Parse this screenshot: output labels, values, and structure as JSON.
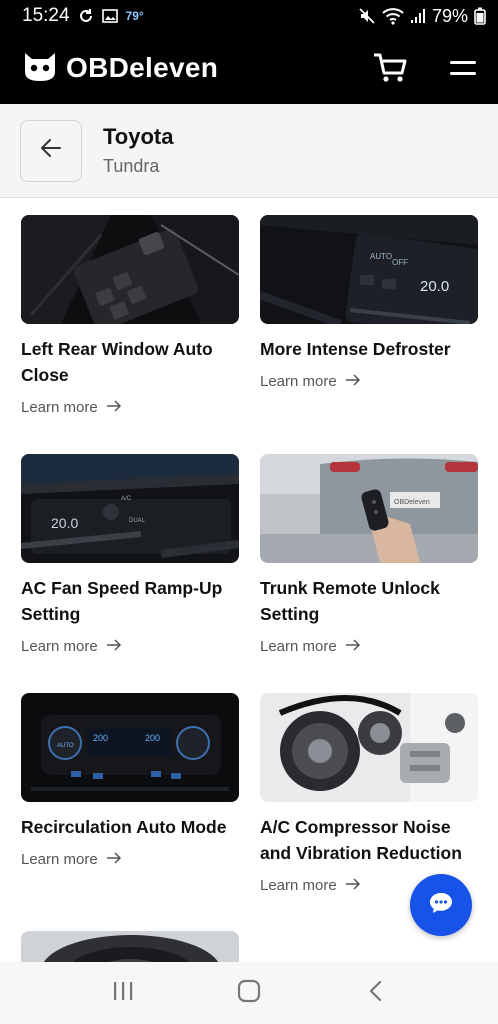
{
  "status_bar": {
    "time": "15:24",
    "temperature": "79°",
    "battery": "79%"
  },
  "header": {
    "app_name": "OBDeleven"
  },
  "vehicle": {
    "make": "Toyota",
    "model": "Tundra"
  },
  "cards": [
    {
      "title": "Left Rear Window Auto Close",
      "learn_more": "Learn more"
    },
    {
      "title": "More Intense Defroster",
      "learn_more": "Learn more"
    },
    {
      "title": "AC Fan Speed Ramp-Up Setting",
      "learn_more": "Learn more"
    },
    {
      "title": "Trunk Remote Unlock Setting",
      "learn_more": "Learn more"
    },
    {
      "title": "Recirculation Auto Mode",
      "learn_more": "Learn more"
    },
    {
      "title": "A/C Compressor Noise and Vibration Reduction",
      "learn_more": "Learn more"
    }
  ],
  "image_labels": {
    "defroster_auto": "AUTO",
    "defroster_off": "OFF",
    "defroster_temp": "20.0",
    "ac_label": "A/C",
    "dual_label": "DUAL",
    "fan_temp": "20.0",
    "recirc_left_temp": "200",
    "recirc_right_temp": "200",
    "recirc_auto": "AUTO",
    "trunk_plate": "OBDeleven"
  },
  "colors": {
    "header_bg": "#000000",
    "accent_blue": "#1753e8",
    "vehicle_bar_bg": "#f5f5f6"
  }
}
